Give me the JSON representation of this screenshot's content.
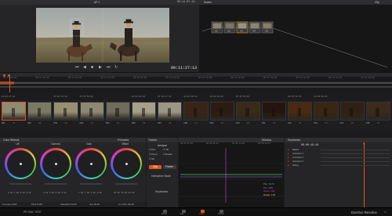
{
  "viewer": {
    "clip_label": "AP 1",
    "header_timecode": "00:11:07:13",
    "current_timecode": "00:11:27:13"
  },
  "nodes": {
    "title": "Nodes",
    "right_label": "Clip",
    "node_labels": [
      "01",
      "02",
      "03",
      "04",
      "05"
    ]
  },
  "timeline_ruler": [
    "00:11:18:00",
    "00:11:25:00",
    "00:11:42:00",
    "00:11:51:00",
    "00:12:02:00",
    "00:12:10:00",
    "00:12:18:00",
    "00:12:26:00",
    "00:12:34:00",
    "00:12:42:00",
    "00:12:50:00",
    "00:12:58:00"
  ],
  "clips": [
    {
      "tc": "01:02:27:10",
      "num": "001",
      "track": "V1",
      "color": "#8f8a72"
    },
    {
      "tc": "",
      "num": "002",
      "track": "V1",
      "color": "#7b7a66"
    },
    {
      "tc": "01:04:23:20",
      "num": "003",
      "track": "V1",
      "color": "#978f74"
    },
    {
      "tc": "01:00:52:08",
      "num": "004",
      "track": "V1",
      "color": "#8d8874"
    },
    {
      "tc": "",
      "num": "005",
      "track": "V1",
      "color": "#6f6c5d"
    },
    {
      "tc": "01:02:08:01",
      "num": "006",
      "track": "V1",
      "color": "#a6a08a"
    },
    {
      "tc": "01:40:27:13",
      "num": "007",
      "track": "V1",
      "color": "#9c9784"
    },
    {
      "tc": "00:01:00:22",
      "num": "008",
      "track": "V1",
      "color": "#3a2416"
    },
    {
      "tc": "00:02:38:03",
      "num": "009",
      "track": "V1",
      "color": "#2c1b12"
    },
    {
      "tc": "00:25:38:26",
      "num": "010",
      "track": "V1",
      "color": "#3a2a18"
    },
    {
      "tc": "",
      "num": "011",
      "track": "V1",
      "color": "#24160e"
    },
    {
      "tc": "00:07:48:15",
      "num": "012",
      "track": "V1",
      "color": "#4a2a12"
    },
    {
      "tc": "00:08:26:05",
      "num": "013",
      "track": "V1",
      "color": "#3b2513"
    },
    {
      "tc": "",
      "num": "014",
      "track": "V1",
      "color": "#2f2014"
    },
    {
      "tc": "",
      "num": "015",
      "track": "V1",
      "color": "#3b2b1b"
    }
  ],
  "color_wheels": {
    "title": "Color Wheels",
    "tab": "Primaries",
    "wheels": [
      {
        "name": "Lift",
        "values": "0.00  0.00  0.00  0.00"
      },
      {
        "name": "Gamma",
        "values": "0.00  0.00  0.00  0.00"
      },
      {
        "name": "Gain",
        "values": "1.00  1.00  1.00  1.00"
      },
      {
        "name": "Offset",
        "values": "25.00 25.00 25.00"
      }
    ],
    "bottom_params": [
      {
        "label": "Contrast",
        "value": "1.000"
      },
      {
        "label": "Pivot",
        "value": "0.435"
      },
      {
        "label": "Saturation",
        "value": "50.00"
      },
      {
        "label": "Hue",
        "value": "50.00"
      },
      {
        "label": "Lum Mix",
        "value": "100.00"
      }
    ]
  },
  "tracker": {
    "title": "Tracker",
    "right_title": "Analyze",
    "controls": [
      "Pan",
      "Tilt",
      "Zoom",
      "Rotate",
      "3D"
    ],
    "buttons": [
      "Clip",
      "Frame"
    ],
    "mode_label": "Interactive Mode",
    "keyframes_label": "Keyframes"
  },
  "graph": {
    "title": "Window",
    "timecodes": [
      "00:00:00:00",
      "00:00:09:13",
      "00:00:19:00",
      "00:00:28:13"
    ],
    "readouts": [
      {
        "label": "Pan: 10.74",
        "color": "#4fc36b"
      },
      {
        "label": "Tilt: -3.88",
        "color": "#9a76e0"
      },
      {
        "label": "Zoom: 1.00",
        "color": "#d040d0"
      },
      {
        "label": "Rotate: 0.00",
        "color": "#e0c040"
      }
    ]
  },
  "keyframes": {
    "title": "Keyframes",
    "timecode": "00:00:19:18",
    "tracks": [
      "Master",
      "Corrector 1",
      "Corrector 2",
      "Corrector 3",
      "Sizing"
    ]
  },
  "footer": {
    "left_label": "PR OWL TEST",
    "tabs": [
      "Media",
      "Edit",
      "Color",
      "Deliver"
    ],
    "active_tab": "Color",
    "app_name": "DaVinci Resolve",
    "accent": "#e0541c"
  }
}
